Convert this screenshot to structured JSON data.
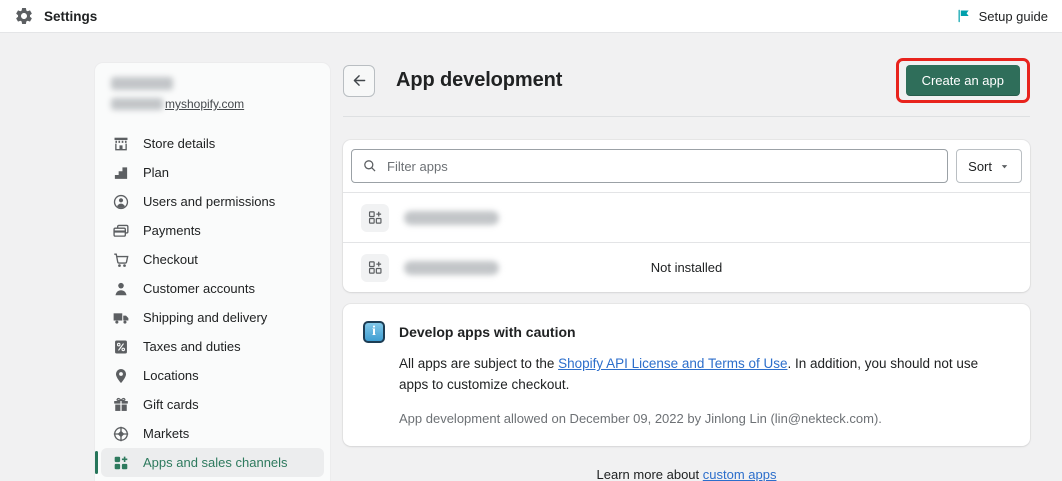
{
  "topbar": {
    "title": "Settings",
    "setup_guide_label": "Setup guide"
  },
  "sidebar": {
    "store_name_redacted": true,
    "store_domain_suffix": "myshopify.com",
    "items": [
      {
        "label": "Store details",
        "icon": "storefront-icon",
        "selected": false
      },
      {
        "label": "Plan",
        "icon": "plan-icon",
        "selected": false
      },
      {
        "label": "Users and permissions",
        "icon": "users-icon",
        "selected": false
      },
      {
        "label": "Payments",
        "icon": "payments-icon",
        "selected": false
      },
      {
        "label": "Checkout",
        "icon": "checkout-icon",
        "selected": false
      },
      {
        "label": "Customer accounts",
        "icon": "customer-icon",
        "selected": false
      },
      {
        "label": "Shipping and delivery",
        "icon": "shipping-icon",
        "selected": false
      },
      {
        "label": "Taxes and duties",
        "icon": "taxes-icon",
        "selected": false
      },
      {
        "label": "Locations",
        "icon": "locations-icon",
        "selected": false
      },
      {
        "label": "Gift cards",
        "icon": "gift-icon",
        "selected": false
      },
      {
        "label": "Markets",
        "icon": "markets-icon",
        "selected": false
      },
      {
        "label": "Apps and sales channels",
        "icon": "apps-icon",
        "selected": true
      }
    ]
  },
  "main": {
    "title": "App development",
    "create_button_label": "Create an app",
    "filter_placeholder": "Filter apps",
    "sort_label": "Sort",
    "apps": [
      {
        "name_redacted": true,
        "status": ""
      },
      {
        "name_redacted": true,
        "status": "Not installed"
      }
    ],
    "banner": {
      "title": "Develop apps with caution",
      "body_before_link": "All apps are subject to the ",
      "body_link": "Shopify API License and Terms of Use",
      "body_after_link": ". In addition, you should not use apps to customize checkout.",
      "note": "App development allowed on December 09, 2022 by Jinlong Lin (lin@nekteck.com)."
    },
    "footer": {
      "text_before_link": "Learn more about ",
      "link": "custom apps"
    }
  },
  "colors": {
    "accent_green": "#2f6e5a",
    "selected_green": "#2e7a5e",
    "annotation_red": "#e8231d",
    "link_blue": "#2c6ecb",
    "setup_guide_teal": "#00a0ac",
    "page_background": "#f1f1f2"
  }
}
